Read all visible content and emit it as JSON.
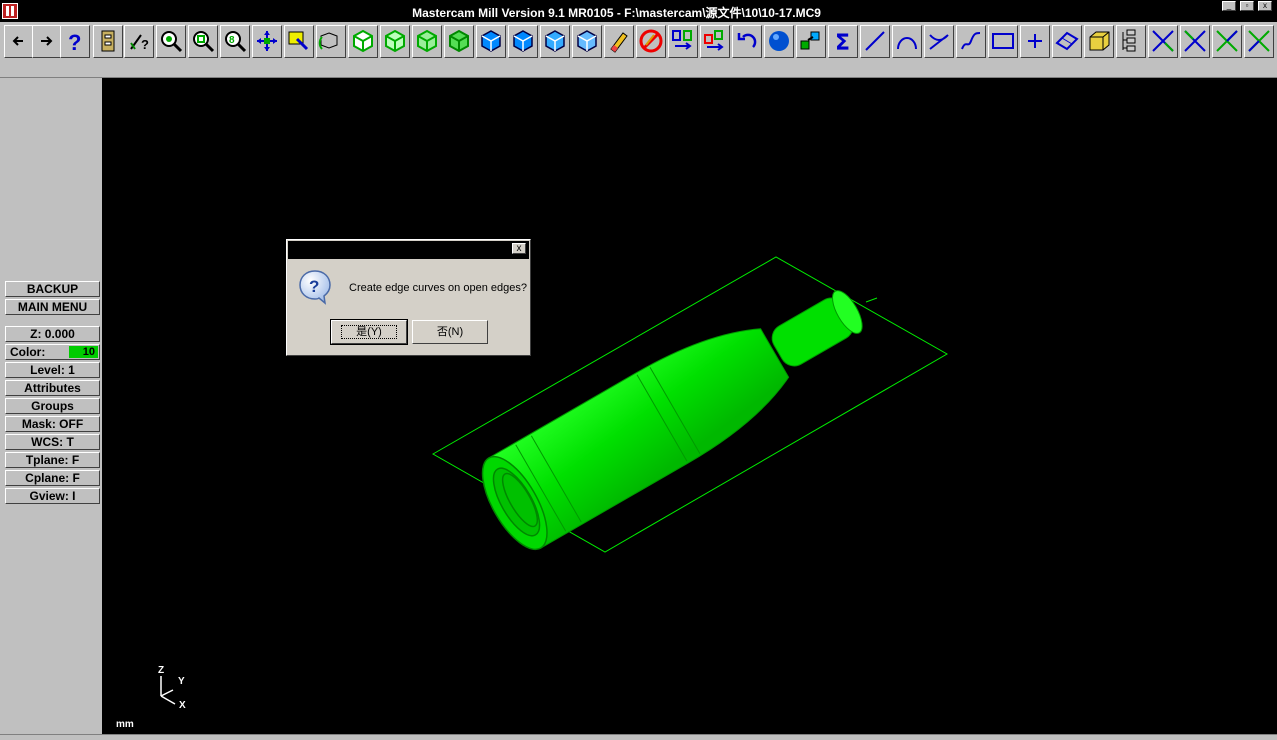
{
  "window": {
    "title": "Mastercam Mill Version 9.1 MR0105 - F:\\mastercam\\源文件\\10\\10-17.MC9",
    "buttons": [
      "minimize",
      "restore",
      "close"
    ]
  },
  "toolbar": {
    "icons": [
      "back-arrow-icon",
      "forward-arrow-icon",
      "help-icon",
      "file-cabinet-icon",
      "pointer-help-icon",
      "zoom-icon",
      "zoom-window-icon",
      "zoom-fit-icon",
      "pan-icon",
      "select-icon",
      "rotate-icon",
      "view-cube-iso-icon",
      "view-cube-top-icon",
      "view-cube-front-icon",
      "view-cube-side-icon",
      "cube-shaded-1-icon",
      "cube-shaded-2-icon",
      "cube-shaded-3-icon",
      "cube-shaded-4-icon",
      "eraser-icon",
      "no-delete-icon",
      "transform-icon",
      "transform-copy-icon",
      "undo-icon",
      "sphere-icon",
      "solid-ops-icon",
      "sigma-icon",
      "line-icon",
      "arc-icon",
      "fillet-icon",
      "spline-icon",
      "rectangle-icon",
      "point-icon",
      "surface-icon",
      "solid-block-icon",
      "tree-icon",
      "trim-icon",
      "trim-2-icon",
      "break-icon",
      "break-2-icon"
    ]
  },
  "menu": {
    "backup": "BACKUP",
    "main_menu": "MAIN MENU",
    "z": "Z:  0.000",
    "color_label": "Color:",
    "color_value": "10",
    "level": "Level:  1",
    "attributes": "Attributes",
    "groups": "Groups",
    "mask": "Mask:  OFF",
    "wcs": "WCS:  T",
    "tplane": "Tplane:  F",
    "cplane": "Cplane:  F",
    "gview": "Gview:  I"
  },
  "viewport": {
    "axis_z": "Z",
    "axis_y": "Y",
    "axis_x": "X",
    "units": "mm",
    "model_color": "#00ee00"
  },
  "dialog": {
    "message": "Create edge curves on open edges?",
    "yes": "是(Y)",
    "no": "否(N)",
    "close": "x"
  }
}
